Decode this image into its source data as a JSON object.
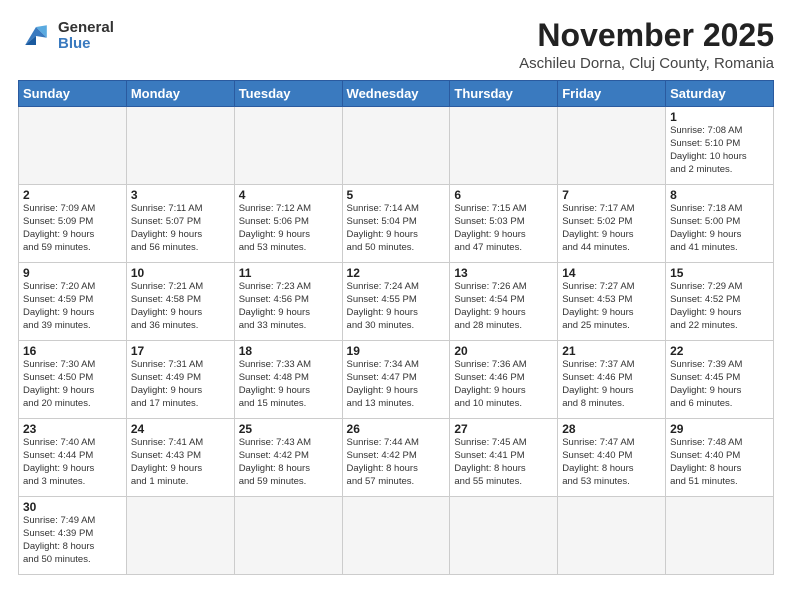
{
  "header": {
    "logo_line1": "General",
    "logo_line2": "Blue",
    "month": "November 2025",
    "location": "Aschileu Dorna, Cluj County, Romania"
  },
  "days_of_week": [
    "Sunday",
    "Monday",
    "Tuesday",
    "Wednesday",
    "Thursday",
    "Friday",
    "Saturday"
  ],
  "weeks": [
    [
      {
        "day": "",
        "info": "",
        "empty": true
      },
      {
        "day": "",
        "info": "",
        "empty": true
      },
      {
        "day": "",
        "info": "",
        "empty": true
      },
      {
        "day": "",
        "info": "",
        "empty": true
      },
      {
        "day": "",
        "info": "",
        "empty": true
      },
      {
        "day": "",
        "info": "",
        "empty": true
      },
      {
        "day": "1",
        "info": "Sunrise: 7:08 AM\nSunset: 5:10 PM\nDaylight: 10 hours\nand 2 minutes."
      }
    ],
    [
      {
        "day": "2",
        "info": "Sunrise: 7:09 AM\nSunset: 5:09 PM\nDaylight: 9 hours\nand 59 minutes."
      },
      {
        "day": "3",
        "info": "Sunrise: 7:11 AM\nSunset: 5:07 PM\nDaylight: 9 hours\nand 56 minutes."
      },
      {
        "day": "4",
        "info": "Sunrise: 7:12 AM\nSunset: 5:06 PM\nDaylight: 9 hours\nand 53 minutes."
      },
      {
        "day": "5",
        "info": "Sunrise: 7:14 AM\nSunset: 5:04 PM\nDaylight: 9 hours\nand 50 minutes."
      },
      {
        "day": "6",
        "info": "Sunrise: 7:15 AM\nSunset: 5:03 PM\nDaylight: 9 hours\nand 47 minutes."
      },
      {
        "day": "7",
        "info": "Sunrise: 7:17 AM\nSunset: 5:02 PM\nDaylight: 9 hours\nand 44 minutes."
      },
      {
        "day": "8",
        "info": "Sunrise: 7:18 AM\nSunset: 5:00 PM\nDaylight: 9 hours\nand 41 minutes."
      }
    ],
    [
      {
        "day": "9",
        "info": "Sunrise: 7:20 AM\nSunset: 4:59 PM\nDaylight: 9 hours\nand 39 minutes."
      },
      {
        "day": "10",
        "info": "Sunrise: 7:21 AM\nSunset: 4:58 PM\nDaylight: 9 hours\nand 36 minutes."
      },
      {
        "day": "11",
        "info": "Sunrise: 7:23 AM\nSunset: 4:56 PM\nDaylight: 9 hours\nand 33 minutes."
      },
      {
        "day": "12",
        "info": "Sunrise: 7:24 AM\nSunset: 4:55 PM\nDaylight: 9 hours\nand 30 minutes."
      },
      {
        "day": "13",
        "info": "Sunrise: 7:26 AM\nSunset: 4:54 PM\nDaylight: 9 hours\nand 28 minutes."
      },
      {
        "day": "14",
        "info": "Sunrise: 7:27 AM\nSunset: 4:53 PM\nDaylight: 9 hours\nand 25 minutes."
      },
      {
        "day": "15",
        "info": "Sunrise: 7:29 AM\nSunset: 4:52 PM\nDaylight: 9 hours\nand 22 minutes."
      }
    ],
    [
      {
        "day": "16",
        "info": "Sunrise: 7:30 AM\nSunset: 4:50 PM\nDaylight: 9 hours\nand 20 minutes."
      },
      {
        "day": "17",
        "info": "Sunrise: 7:31 AM\nSunset: 4:49 PM\nDaylight: 9 hours\nand 17 minutes."
      },
      {
        "day": "18",
        "info": "Sunrise: 7:33 AM\nSunset: 4:48 PM\nDaylight: 9 hours\nand 15 minutes."
      },
      {
        "day": "19",
        "info": "Sunrise: 7:34 AM\nSunset: 4:47 PM\nDaylight: 9 hours\nand 13 minutes."
      },
      {
        "day": "20",
        "info": "Sunrise: 7:36 AM\nSunset: 4:46 PM\nDaylight: 9 hours\nand 10 minutes."
      },
      {
        "day": "21",
        "info": "Sunrise: 7:37 AM\nSunset: 4:46 PM\nDaylight: 9 hours\nand 8 minutes."
      },
      {
        "day": "22",
        "info": "Sunrise: 7:39 AM\nSunset: 4:45 PM\nDaylight: 9 hours\nand 6 minutes."
      }
    ],
    [
      {
        "day": "23",
        "info": "Sunrise: 7:40 AM\nSunset: 4:44 PM\nDaylight: 9 hours\nand 3 minutes."
      },
      {
        "day": "24",
        "info": "Sunrise: 7:41 AM\nSunset: 4:43 PM\nDaylight: 9 hours\nand 1 minute."
      },
      {
        "day": "25",
        "info": "Sunrise: 7:43 AM\nSunset: 4:42 PM\nDaylight: 8 hours\nand 59 minutes."
      },
      {
        "day": "26",
        "info": "Sunrise: 7:44 AM\nSunset: 4:42 PM\nDaylight: 8 hours\nand 57 minutes."
      },
      {
        "day": "27",
        "info": "Sunrise: 7:45 AM\nSunset: 4:41 PM\nDaylight: 8 hours\nand 55 minutes."
      },
      {
        "day": "28",
        "info": "Sunrise: 7:47 AM\nSunset: 4:40 PM\nDaylight: 8 hours\nand 53 minutes."
      },
      {
        "day": "29",
        "info": "Sunrise: 7:48 AM\nSunset: 4:40 PM\nDaylight: 8 hours\nand 51 minutes."
      }
    ],
    [
      {
        "day": "30",
        "info": "Sunrise: 7:49 AM\nSunset: 4:39 PM\nDaylight: 8 hours\nand 50 minutes."
      },
      {
        "day": "",
        "info": "",
        "empty": true
      },
      {
        "day": "",
        "info": "",
        "empty": true
      },
      {
        "day": "",
        "info": "",
        "empty": true
      },
      {
        "day": "",
        "info": "",
        "empty": true
      },
      {
        "day": "",
        "info": "",
        "empty": true
      },
      {
        "day": "",
        "info": "",
        "empty": true
      }
    ]
  ]
}
